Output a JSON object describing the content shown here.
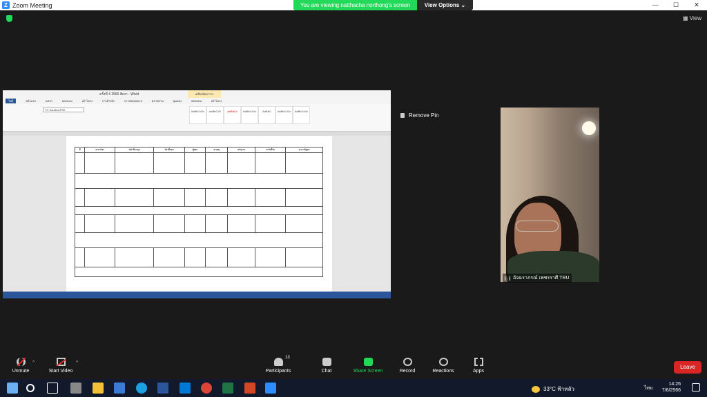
{
  "window": {
    "app_title": "Zoom Meeting",
    "logo_letter": "Z",
    "controls": {
      "minimize": "—",
      "maximize": "☐",
      "close": "✕"
    }
  },
  "share_banner": {
    "message": "You are viewing natthacha northong's screen",
    "view_options": "View Options ⌄"
  },
  "top_right": {
    "view_label": "View"
  },
  "shared_window": {
    "doc_title": "ครั้งที่ 4 2566 สีเทา - Word",
    "context_tab": "เครื่องมือตาราง",
    "ribbon_tabs": [
      "ไฟล์",
      "หน้าแรก",
      "แทรก",
      "ออกแบบ",
      "เค้าโครง",
      "การอ้างอิง",
      "การส่งจดหมาย",
      "ตรวจทาน",
      "มุมมอง",
      "ออกแบบ",
      "เค้าโครง"
    ],
    "font_name": "TH SarabunPSK",
    "styles": [
      "AaBbCcDc",
      "AaBbCcD",
      "AaBbCc",
      "AaBbCcDc",
      "AaBbC",
      "AaBbCcDc",
      "AaBbCcDc"
    ],
    "table_headers": [
      "ที่",
      "สาขาวิชา",
      "รหัส ชื่อ-สกุล",
      "วิชาที่สอน",
      "ผู้สอน",
      "สาเหตุ",
      "หลักฐาน",
      "ลงวันที่รับ",
      "อาจารย์ดูแล"
    ]
  },
  "pin": {
    "label": "Remove Pin"
  },
  "participant": {
    "name": "อัจฉราภรณ์ เพชรราศี TRU"
  },
  "toolbar": {
    "unmute": "Unmute",
    "start_video": "Start Video",
    "participants": "Participants",
    "participants_count": "13",
    "chat": "Chat",
    "share_screen": "Share Screen",
    "record": "Record",
    "reactions": "Reactions",
    "apps": "Apps",
    "leave": "Leave"
  },
  "taskbar": {
    "weather_temp": "33°C",
    "weather_text": "ฟ้าหลัว",
    "language": "ไทย",
    "time": "14:26",
    "date": "7/6/2566"
  },
  "colors": {
    "zoom_green": "#23d959",
    "leave_red": "#d82525",
    "word_blue": "#2b579a"
  }
}
